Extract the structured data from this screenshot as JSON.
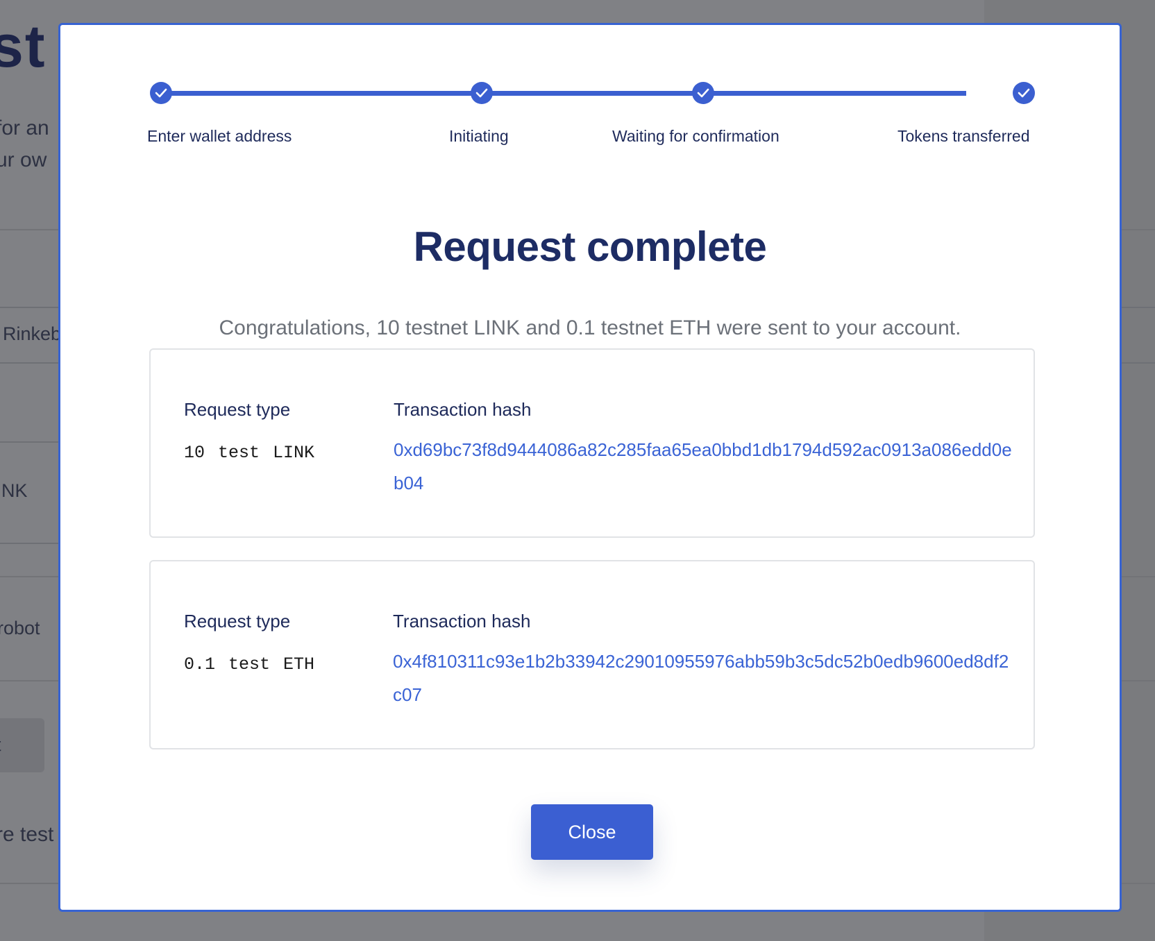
{
  "background": {
    "title_fragment": "st t",
    "text_fragments": [
      "for an",
      "ur ow",
      "Rinkeb",
      "NK",
      "robot",
      "t",
      "re test"
    ]
  },
  "modal": {
    "steps": [
      {
        "label": "Enter wallet address",
        "completed": true,
        "icon": "check-icon"
      },
      {
        "label": "Initiating",
        "completed": true,
        "icon": "check-icon"
      },
      {
        "label": "Waiting for confirmation",
        "completed": true,
        "icon": "check-icon"
      },
      {
        "label": "Tokens transferred",
        "completed": true,
        "icon": "check-icon"
      }
    ],
    "title": "Request complete",
    "message": "Congratulations, 10 testnet LINK and 0.1 testnet ETH were sent to your account.",
    "requests": [
      {
        "type_label": "Request type",
        "amount": "10 test LINK",
        "hash_label": "Transaction hash",
        "hash": "0xd69bc73f8d9444086a82c285faa65ea0bbd1db1794d592ac0913a086edd0eb04"
      },
      {
        "type_label": "Request type",
        "amount": "0.1 test ETH",
        "hash_label": "Transaction hash",
        "hash": "0x4f810311c93e1b2b33942c29010955976abb59b3c5dc52b0edb9600ed8df2c07"
      }
    ],
    "close_label": "Close"
  },
  "colors": {
    "accent": "#3b5fd0",
    "heading": "#1d2c64",
    "link": "#3a63d5",
    "overlay": "#808185"
  }
}
